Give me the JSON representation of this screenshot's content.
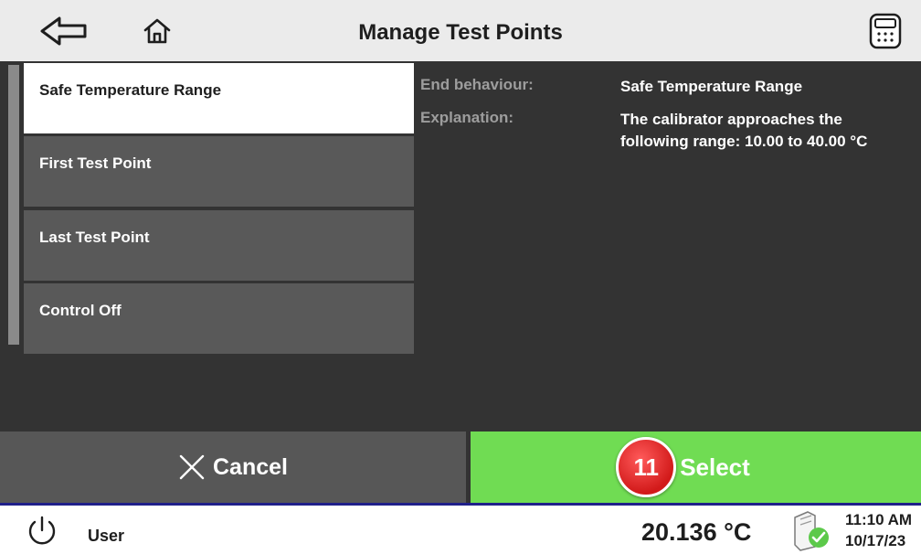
{
  "header": {
    "title": "Manage Test Points",
    "back_icon": "back-arrow-icon",
    "home_icon": "home-icon",
    "calculator_icon": "calculator-icon"
  },
  "list": {
    "items": [
      {
        "label": "Safe Temperature Range",
        "selected": true
      },
      {
        "label": "First Test Point",
        "selected": false
      },
      {
        "label": "Last Test Point",
        "selected": false
      },
      {
        "label": "Control Off",
        "selected": false
      }
    ]
  },
  "details": {
    "end_behaviour_label": "End behaviour:",
    "end_behaviour_value": "Safe Temperature Range",
    "explanation_label": "Explanation:",
    "explanation_value": "The calibrator approaches the following range:  10.00 to 40.00 °C"
  },
  "actions": {
    "cancel_label": "Cancel",
    "select_label": "Select",
    "step_badge": "11"
  },
  "status": {
    "user": "User",
    "temperature": "20.136 °C",
    "time": "11:10 AM",
    "date": "10/17/23",
    "power_icon": "power-icon",
    "device_icon": "device-ok-icon"
  },
  "colors": {
    "header_bg": "#ebebeb",
    "panel_bg": "#333333",
    "item_bg": "#595959",
    "selected_bg": "#ffffff",
    "select_green": "#70dc53",
    "badge_red": "#d21a1a",
    "status_line": "#20208a"
  }
}
